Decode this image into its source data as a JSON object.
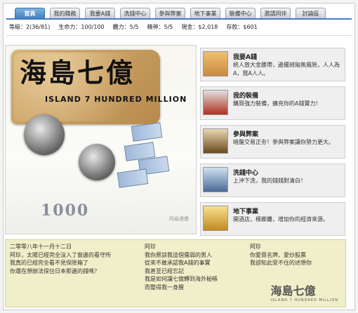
{
  "tabs": [
    "首頁",
    "我的職務",
    "我要A錢",
    "洗錢中心",
    "參與弊案",
    "地下事業",
    "裝備中心",
    "邀請同伴",
    "討論區"
  ],
  "stats": {
    "level_label": "等級：",
    "level_value": "2(36/81)",
    "life_label": "生命力：",
    "life_value": "100/100",
    "stamina_label": "體力：",
    "stamina_value": "5/5",
    "spirit_label": "精神：",
    "spirit_value": "5/5",
    "cash_label": "現金：",
    "cash_value": "$2,018",
    "deposit_label": "存款：",
    "deposit_value": "$601"
  },
  "hero": {
    "logo_cn": "海島七億",
    "logo_en": "ISLAND 7 HUNDRED MILLION",
    "number": "1000",
    "signature": "阿扁漫畫"
  },
  "cards": [
    {
      "title": "我要A錢",
      "desc": "統人放大金腰帶，邊擺縫隘無風險，人人為A，我A人人。",
      "avatar_color": "#d9a35a"
    },
    {
      "title": "我的裝備",
      "desc": "購買強力裝備，擴充你的A錢實力！",
      "avatar_color": "#c04030"
    },
    {
      "title": "參與弊案",
      "desc": "暗盤交易正夯！參與弊案讓你勢力更大。",
      "avatar_color": "#7a5a2a"
    },
    {
      "title": "洗錢中心",
      "desc": "上沖下洗，我的錢錢對清白！",
      "avatar_color": "#5a7aa8"
    },
    {
      "title": "地下事業",
      "desc": "開酒店，檳榔攤，增加你的經濟來源。",
      "avatar_color": "#d8b040"
    }
  ],
  "news": {
    "col1": [
      "二零零八年十一月十二日",
      "阿珍，太陽已經完全沒入了窗邊的看守所",
      "我真的已經完全看不見保險箱了",
      "你還在想辦法保住日本那邊的錢嗎？"
    ],
    "col2": [
      "阿珍",
      "我你原諒我這個儒弱的男人",
      "從來不敢承認我A錢的事實",
      "我甚至已經忘記",
      "我是如何讓七億轉到海外秘帳",
      "而整得我一身腥"
    ],
    "col3": [
      "阿珍",
      "你愛買名牌、愛炒股票",
      "我卻知此受不住的述想你"
    ],
    "stamp_cn": "海島七億",
    "stamp_en": "ISLAND 7 HUNDRED MILLION"
  }
}
